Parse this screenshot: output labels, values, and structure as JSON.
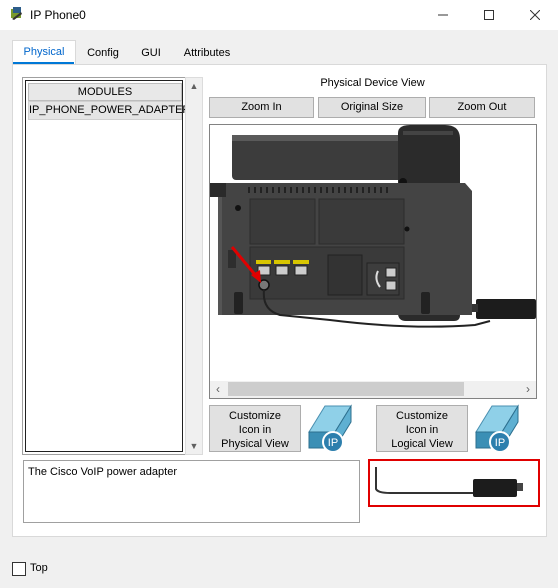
{
  "window": {
    "title": "IP Phone0",
    "minimize_icon": "minimize-icon",
    "maximize_icon": "maximize-icon",
    "close_icon": "close-icon"
  },
  "tabs": [
    {
      "label": "Physical",
      "active": true
    },
    {
      "label": "Config",
      "active": false
    },
    {
      "label": "GUI",
      "active": false
    },
    {
      "label": "Attributes",
      "active": false
    }
  ],
  "modules": {
    "header": "MODULES",
    "items": [
      "IP_PHONE_POWER_ADAPTER"
    ]
  },
  "device_view": {
    "title": "Physical Device View",
    "zoom_in": "Zoom In",
    "original_size": "Original Size",
    "zoom_out": "Zoom Out"
  },
  "customize": {
    "physical": "Customize\nIcon in\nPhysical View",
    "logical": "Customize\nIcon in\nLogical View",
    "ip_badge": "IP"
  },
  "description": "The Cisco VoIP power adapter",
  "footer": {
    "top_label": "Top",
    "top_checked": false
  },
  "colors": {
    "accent": "#0078d7",
    "highlight": "#e00000"
  }
}
